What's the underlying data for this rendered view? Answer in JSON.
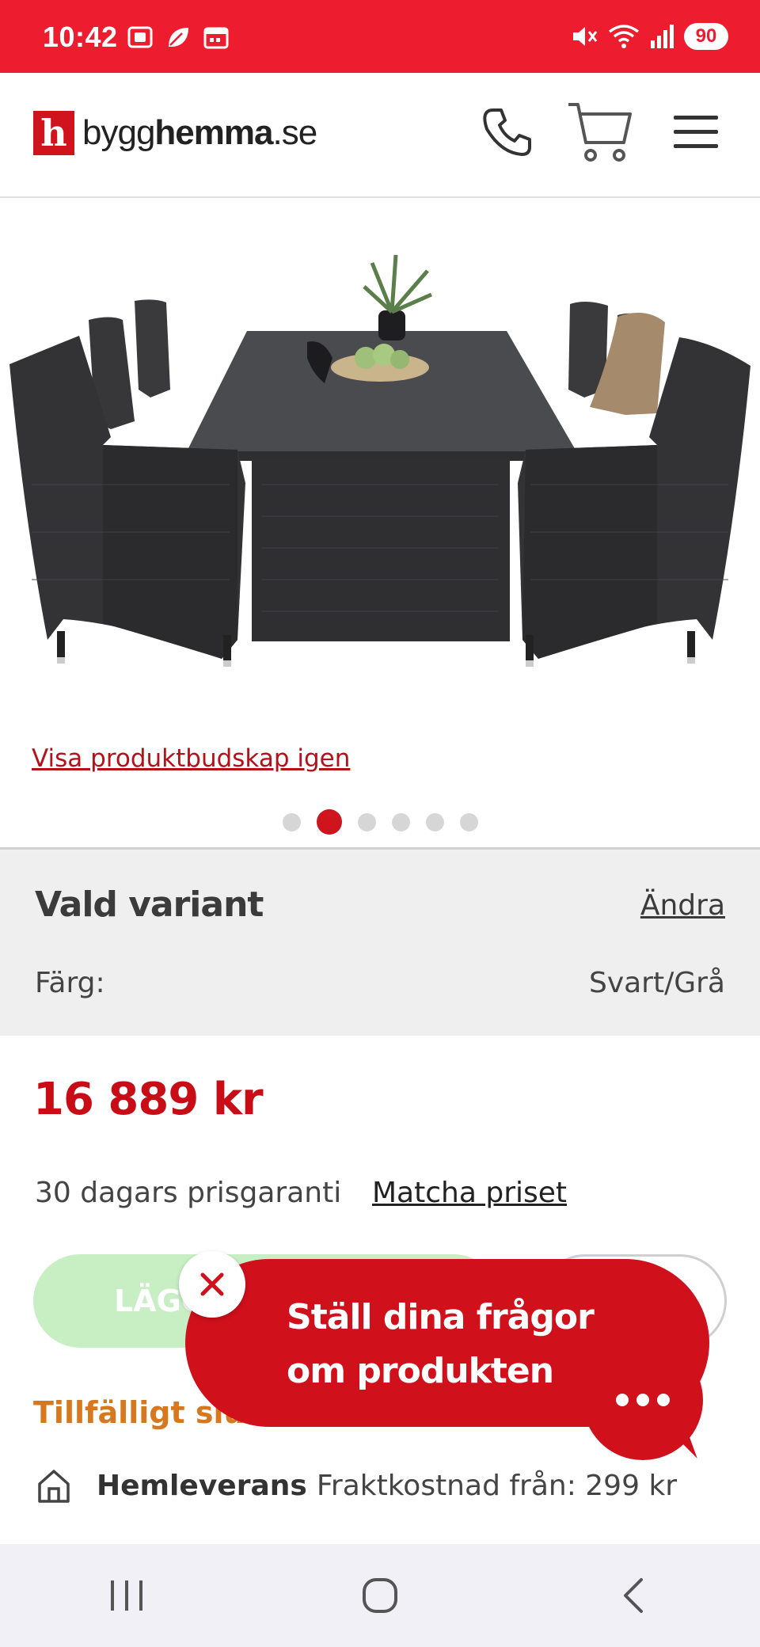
{
  "status_bar": {
    "time": "10:42",
    "battery": "90",
    "left_icons": [
      "screenshot-icon",
      "leaf-icon",
      "calendar-icon"
    ],
    "right_icons": [
      "mute-icon",
      "wifi-icon",
      "signal-icon"
    ],
    "color": "#ee1c2f"
  },
  "header": {
    "logo_mark": "h",
    "logo_prefix": "bygg",
    "logo_bold": "hemma",
    "logo_suffix": ".se",
    "icons": [
      "phone-icon",
      "cart-icon",
      "menu-icon"
    ]
  },
  "product": {
    "image_alt": "Svart konstrottingsmatgrupp med bord och sex stolar",
    "restore_message_link": "Visa produktbudskap igen",
    "carousel": {
      "count": 6,
      "active_index": 1
    }
  },
  "variant": {
    "title": "Vald variant",
    "change_link": "Ändra",
    "color_label": "Färg:",
    "color_value": "Svart/Grå"
  },
  "pricing": {
    "price": "16 889 kr",
    "guarantee": "30 dagars prisgaranti",
    "match_link": "Matcha priset"
  },
  "actions": {
    "add_to_cart_visible": "LÄGG"
  },
  "stock": {
    "status_visible": "Tillfälligt slut"
  },
  "delivery": {
    "label": "Hemleverans",
    "text": "Fraktkostnad från: 299 kr"
  },
  "chat": {
    "text_line1": "Ställ dina frågor",
    "text_line2": "om produkten"
  },
  "colors": {
    "brand_red": "#d0141e",
    "price_red": "#c90d17",
    "stock_orange": "#d8781e",
    "add_button_green": "#c8efc4"
  }
}
